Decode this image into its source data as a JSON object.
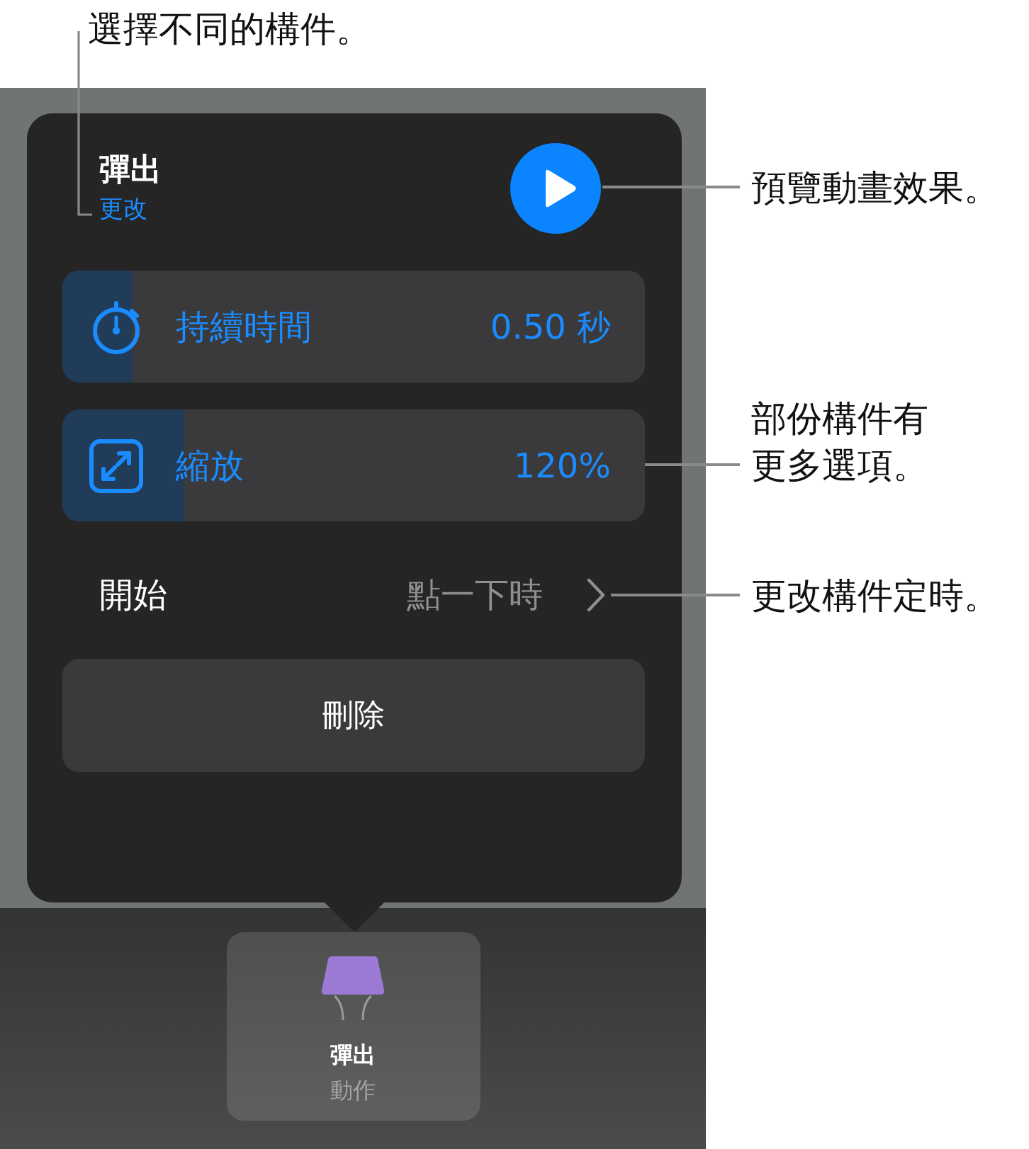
{
  "callouts": {
    "top": "選擇不同的構件。",
    "right": [
      "預覽動畫效果。",
      "部份構件有更多選項。",
      "更改構件定時。"
    ]
  },
  "popover": {
    "title": "彈出",
    "change_link": "更改",
    "sliders": [
      {
        "label": "持續時間",
        "value": "0.50 秒",
        "level": 0.12
      },
      {
        "label": "縮放",
        "value": "120%",
        "level": 0.21
      }
    ],
    "start": {
      "label": "開始",
      "value": "點一下時"
    },
    "delete_button": "刪除"
  },
  "toolbar": {
    "tile": {
      "title": "彈出",
      "subtitle": "動作",
      "selected": true
    }
  }
}
